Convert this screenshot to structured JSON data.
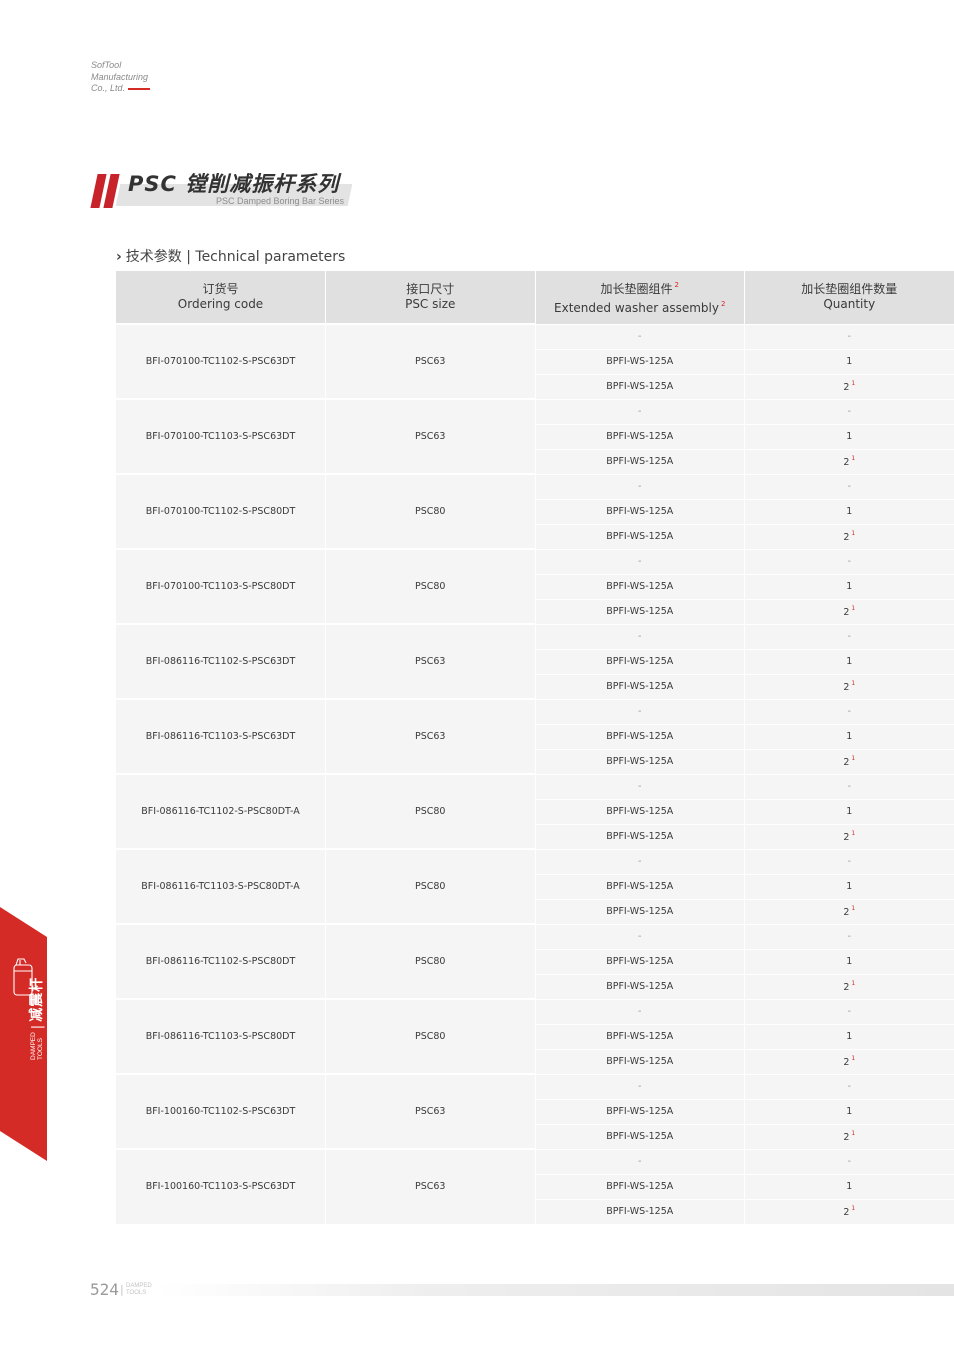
{
  "company": {
    "line1": "SofTool",
    "line2": "Manufacturing",
    "line3": "Co., Ltd."
  },
  "banner": {
    "title": "PSC 镗削减振杆系列",
    "subtitle": "PSC Damped Boring Bar Series",
    "accent_color": "#c8232a"
  },
  "section": {
    "chevron": "›",
    "title": "技术参数 | Technical parameters"
  },
  "table": {
    "headers": [
      {
        "cn": "订货号",
        "en": "Ordering code",
        "note": ""
      },
      {
        "cn": "接口尺寸",
        "en": "PSC size",
        "note": ""
      },
      {
        "cn": "加长垫圈组件",
        "en": "Extended washer assembly",
        "note": "2"
      },
      {
        "cn": "加长垫圈组件数量",
        "en": "Quantity",
        "note": ""
      }
    ],
    "rows": [
      {
        "code": "BFI-070100-TC1102-S-PSC63DT",
        "size": "PSC63",
        "options": [
          {
            "assembly": "-",
            "qty": "-",
            "note": ""
          },
          {
            "assembly": "BPFI-WS-125A",
            "qty": "1",
            "note": ""
          },
          {
            "assembly": "BPFI-WS-125A",
            "qty": "2",
            "note": "1"
          }
        ]
      },
      {
        "code": "BFI-070100-TC1103-S-PSC63DT",
        "size": "PSC63",
        "options": [
          {
            "assembly": "-",
            "qty": "-",
            "note": ""
          },
          {
            "assembly": "BPFI-WS-125A",
            "qty": "1",
            "note": ""
          },
          {
            "assembly": "BPFI-WS-125A",
            "qty": "2",
            "note": "1"
          }
        ]
      },
      {
        "code": "BFI-070100-TC1102-S-PSC80DT",
        "size": "PSC80",
        "options": [
          {
            "assembly": "-",
            "qty": "-",
            "note": ""
          },
          {
            "assembly": "BPFI-WS-125A",
            "qty": "1",
            "note": ""
          },
          {
            "assembly": "BPFI-WS-125A",
            "qty": "2",
            "note": "1"
          }
        ]
      },
      {
        "code": "BFI-070100-TC1103-S-PSC80DT",
        "size": "PSC80",
        "options": [
          {
            "assembly": "-",
            "qty": "-",
            "note": ""
          },
          {
            "assembly": "BPFI-WS-125A",
            "qty": "1",
            "note": ""
          },
          {
            "assembly": "BPFI-WS-125A",
            "qty": "2",
            "note": "1"
          }
        ]
      },
      {
        "code": "BFI-086116-TC1102-S-PSC63DT",
        "size": "PSC63",
        "options": [
          {
            "assembly": "-",
            "qty": "-",
            "note": ""
          },
          {
            "assembly": "BPFI-WS-125A",
            "qty": "1",
            "note": ""
          },
          {
            "assembly": "BPFI-WS-125A",
            "qty": "2",
            "note": "1"
          }
        ]
      },
      {
        "code": "BFI-086116-TC1103-S-PSC63DT",
        "size": "PSC63",
        "options": [
          {
            "assembly": "-",
            "qty": "-",
            "note": ""
          },
          {
            "assembly": "BPFI-WS-125A",
            "qty": "1",
            "note": ""
          },
          {
            "assembly": "BPFI-WS-125A",
            "qty": "2",
            "note": "1"
          }
        ]
      },
      {
        "code": "BFI-086116-TC1102-S-PSC80DT-A",
        "size": "PSC80",
        "options": [
          {
            "assembly": "-",
            "qty": "-",
            "note": ""
          },
          {
            "assembly": "BPFI-WS-125A",
            "qty": "1",
            "note": ""
          },
          {
            "assembly": "BPFI-WS-125A",
            "qty": "2",
            "note": "1"
          }
        ]
      },
      {
        "code": "BFI-086116-TC1103-S-PSC80DT-A",
        "size": "PSC80",
        "options": [
          {
            "assembly": "-",
            "qty": "-",
            "note": ""
          },
          {
            "assembly": "BPFI-WS-125A",
            "qty": "1",
            "note": ""
          },
          {
            "assembly": "BPFI-WS-125A",
            "qty": "2",
            "note": "1"
          }
        ]
      },
      {
        "code": "BFI-086116-TC1102-S-PSC80DT",
        "size": "PSC80",
        "options": [
          {
            "assembly": "-",
            "qty": "-",
            "note": ""
          },
          {
            "assembly": "BPFI-WS-125A",
            "qty": "1",
            "note": ""
          },
          {
            "assembly": "BPFI-WS-125A",
            "qty": "2",
            "note": "1"
          }
        ]
      },
      {
        "code": "BFI-086116-TC1103-S-PSC80DT",
        "size": "PSC80",
        "options": [
          {
            "assembly": "-",
            "qty": "-",
            "note": ""
          },
          {
            "assembly": "BPFI-WS-125A",
            "qty": "1",
            "note": ""
          },
          {
            "assembly": "BPFI-WS-125A",
            "qty": "2",
            "note": "1"
          }
        ]
      },
      {
        "code": "BFI-100160-TC1102-S-PSC63DT",
        "size": "PSC63",
        "options": [
          {
            "assembly": "-",
            "qty": "-",
            "note": ""
          },
          {
            "assembly": "BPFI-WS-125A",
            "qty": "1",
            "note": ""
          },
          {
            "assembly": "BPFI-WS-125A",
            "qty": "2",
            "note": "1"
          }
        ]
      },
      {
        "code": "BFI-100160-TC1103-S-PSC63DT",
        "size": "PSC63",
        "options": [
          {
            "assembly": "-",
            "qty": "-",
            "note": ""
          },
          {
            "assembly": "BPFI-WS-125A",
            "qty": "1",
            "note": ""
          },
          {
            "assembly": "BPFI-WS-125A",
            "qty": "2",
            "note": "1"
          }
        ]
      }
    ]
  },
  "side_tab": {
    "cn": "减震杆",
    "separator": "|",
    "en_line1": "DAMPED",
    "en_line2": "TOOLS",
    "color": "#d52b27",
    "icon": "damped-tool-icon"
  },
  "footer": {
    "page": "524",
    "separator": "|",
    "tag_line1": "DAMPED",
    "tag_line2": "TOOLS"
  }
}
